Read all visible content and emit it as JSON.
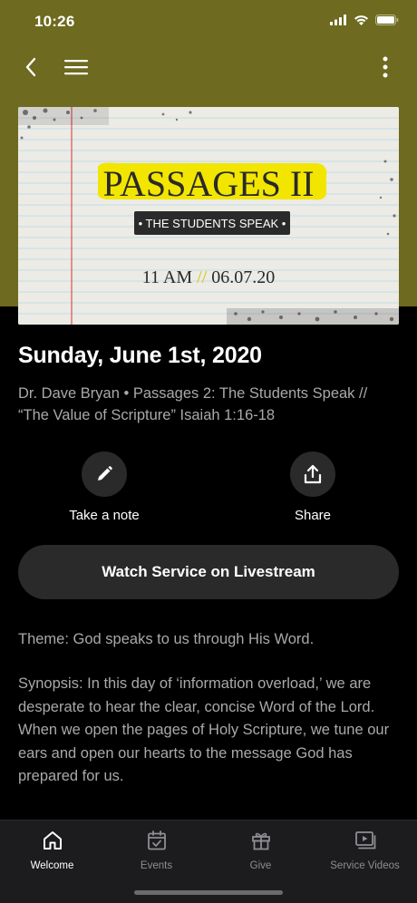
{
  "status_bar": {
    "time": "10:26"
  },
  "nav": {
    "back_icon": "chevron-left-icon",
    "menu_icon": "hamburger-icon",
    "more_icon": "more-vertical-icon"
  },
  "hero": {
    "headline": "PASSAGES II",
    "tagline": "• THE STUDENTS SPEAK •",
    "time": "11 AM",
    "separator": "//",
    "date": "06.07.20",
    "colors": {
      "highlight": "#f2e600",
      "paper": "#ecebe6",
      "margin_line": "#d9534f",
      "rule_line": "#b9d7e2"
    }
  },
  "sermon": {
    "title": "Sunday, June 1st, 2020",
    "subtitle": "Dr. Dave Bryan • Passages 2: The Students Speak  //  “The Value of Scripture” Isaiah 1:16-18",
    "theme": "Theme: God speaks to us through His Word.",
    "synopsis": "Synopsis:  In this day of ‘information overload,’ we are desperate to hear the clear, concise Word of the Lord.  When we open the pages of Holy Scripture, we tune our ears and open our hearts to the message God has prepared for us."
  },
  "actions": {
    "note_label": "Take a note",
    "share_label": "Share",
    "watch_label": "Watch Service on Livestream"
  },
  "tabs": [
    {
      "label": "Welcome",
      "icon": "home-icon",
      "active": true
    },
    {
      "label": "Events",
      "icon": "calendar-check-icon",
      "active": false
    },
    {
      "label": "Give",
      "icon": "gift-icon",
      "active": false
    },
    {
      "label": "Service Videos",
      "icon": "video-library-icon",
      "active": false
    }
  ],
  "colors": {
    "header_band": "#6e6a1f",
    "background": "#000000",
    "button": "#2a2a2a",
    "muted_text": "#a9a9a9"
  }
}
